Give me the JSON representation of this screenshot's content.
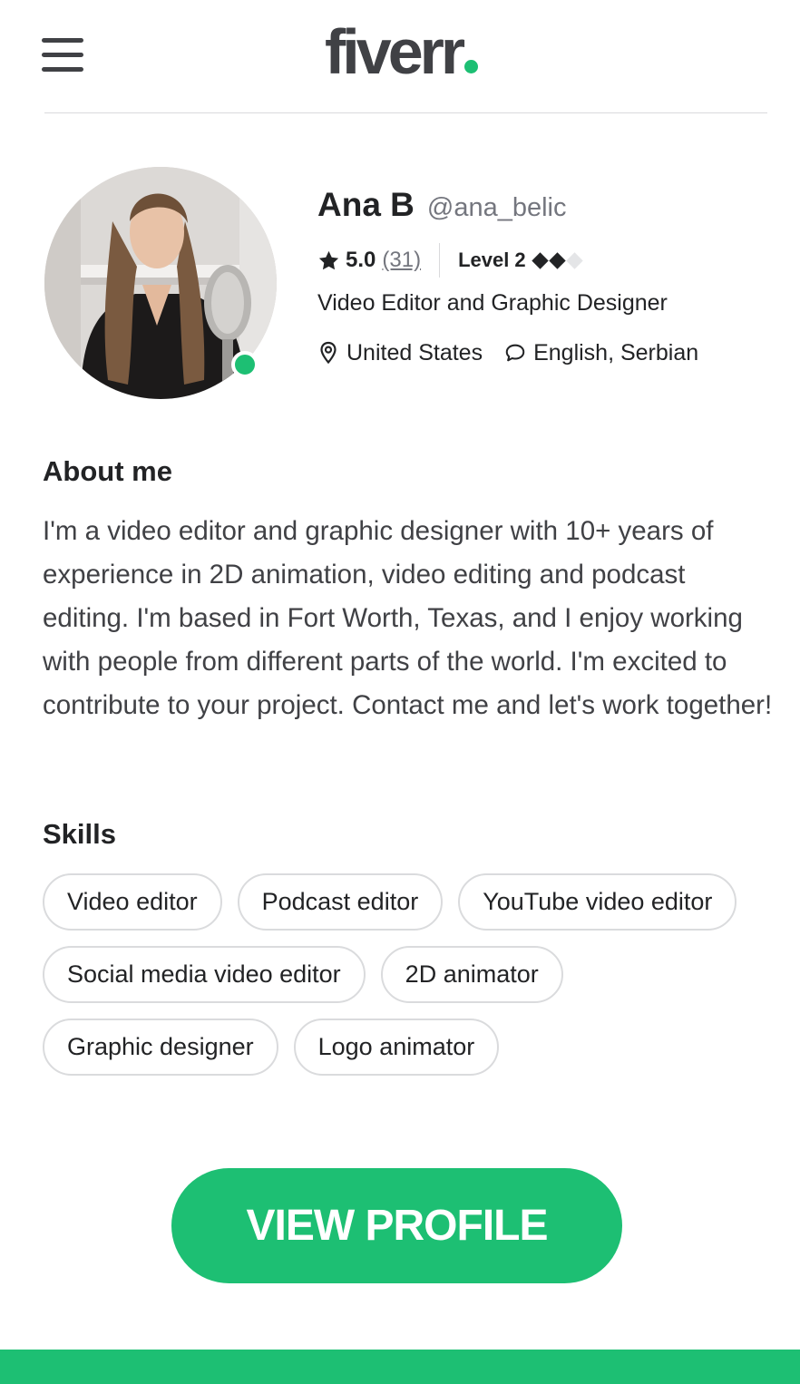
{
  "header": {
    "logo_text": "fiverr",
    "menu_icon": "hamburger-menu-icon"
  },
  "profile": {
    "name": "Ana B",
    "username": "@ana_belic",
    "rating": "5.0",
    "review_count": "(31)",
    "level_label": "Level 2",
    "level_value": 2,
    "level_max": 3,
    "title": "Video Editor and Graphic Designer",
    "location": "United States",
    "languages": "English, Serbian",
    "online": true
  },
  "about": {
    "heading": "About me",
    "text": "I'm a video editor and graphic designer with 10+ years of experience in 2D animation, video editing and podcast editing. I'm based in Fort Worth, Texas, and I enjoy working with people from different parts of the world. I'm excited to contribute to your project. Contact me and let's work together!"
  },
  "skills": {
    "heading": "Skills",
    "items": [
      "Video editor",
      "Podcast editor",
      "YouTube video editor",
      "Social media video editor",
      "2D animator",
      "Graphic designer",
      "Logo animator"
    ]
  },
  "cta": {
    "label": "VIEW PROFILE"
  },
  "colors": {
    "brand_green": "#1dbf73",
    "text_dark": "#222325",
    "text_muted": "#74767e"
  }
}
